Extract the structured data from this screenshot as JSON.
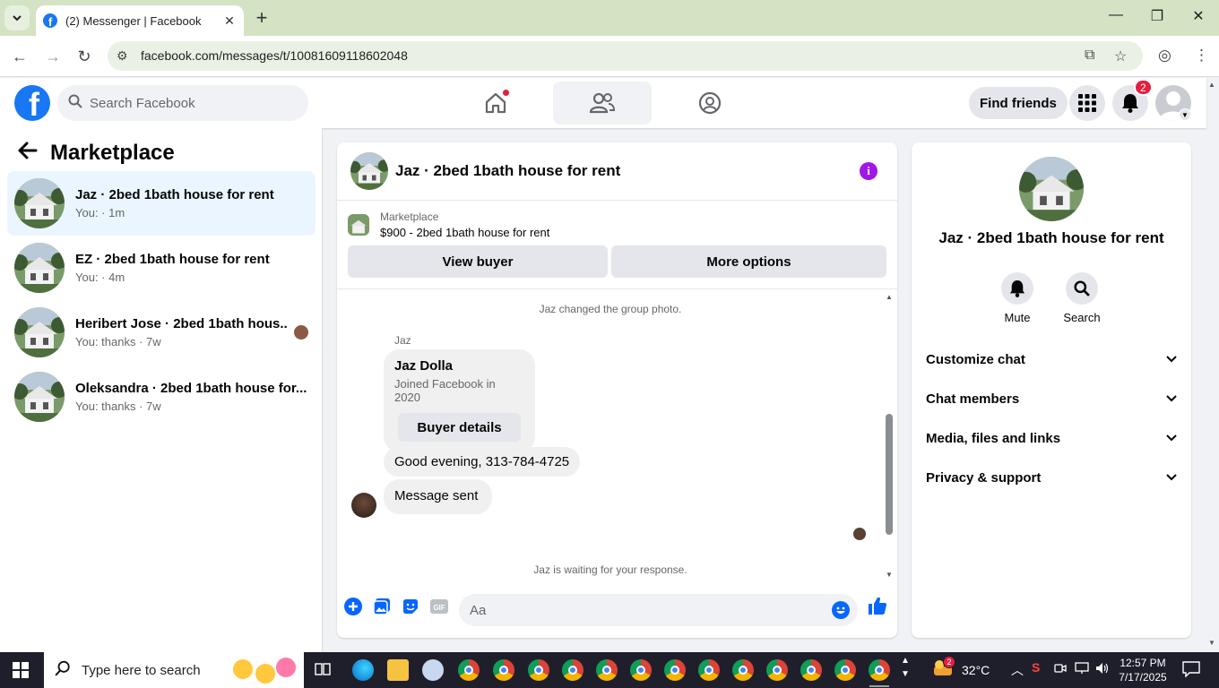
{
  "browser": {
    "tab_title": "(2) Messenger | Facebook",
    "url": "facebook.com/messages/t/10081609118602048"
  },
  "header": {
    "search_placeholder": "Search Facebook",
    "find_friends_label": "Find friends",
    "notification_count": "2"
  },
  "left_panel": {
    "title": "Marketplace",
    "conversations": [
      {
        "name": "Jaz · 2bed 1bath house for rent",
        "sub": "You: · 1m",
        "active": true
      },
      {
        "name": "EZ · 2bed 1bath house for rent",
        "sub": "You: · 4m"
      },
      {
        "name": "Heribert Jose · 2bed 1bath hous...",
        "sub": "You: thanks · 7w"
      },
      {
        "name": "Oleksandra · 2bed 1bath house for...",
        "sub": "You: thanks · 7w"
      }
    ]
  },
  "chat": {
    "title": "Jaz · 2bed 1bath house for rent",
    "listing_label": "Marketplace",
    "listing_price": "$900 - 2bed 1bath house for rent",
    "view_buyer_label": "View buyer",
    "more_options_label": "More options",
    "system_photo_change": "Jaz changed the group photo.",
    "sender_name": "Jaz",
    "card_name": "Jaz Dolla",
    "card_joined": "Joined Facebook in 2020",
    "buyer_details_label": "Buyer details",
    "message_1": "Good evening, 313-784-4725",
    "message_2": "Message sent",
    "waiting_text": "Jaz is waiting for your response.",
    "input_placeholder": "Aa"
  },
  "right_panel": {
    "name": "Jaz · 2bed 1bath house for rent",
    "mute_label": "Mute",
    "search_label": "Search",
    "sections": [
      "Customize chat",
      "Chat members",
      "Media, files and links",
      "Privacy & support"
    ]
  },
  "taskbar": {
    "search_placeholder": "Type here to search",
    "weather": "32°C",
    "time": "12:57 PM",
    "date": "7/17/2025",
    "weather_badge": "2"
  }
}
